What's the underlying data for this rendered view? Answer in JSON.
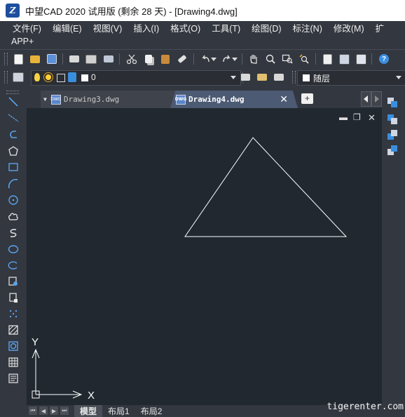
{
  "window": {
    "title": "中望CAD 2020 试用版 (剩余 28 天) - [Drawing4.dwg]",
    "logo_text": "Z"
  },
  "menu": {
    "items": [
      "文件(F)",
      "编辑(E)",
      "视图(V)",
      "插入(I)",
      "格式(O)",
      "工具(T)",
      "绘图(D)",
      "标注(N)",
      "修改(M)",
      "扩"
    ],
    "row2": [
      "APP+"
    ]
  },
  "layer_toolbar": {
    "current_layer": "0",
    "color_value": "随层"
  },
  "tabs": [
    {
      "label": "Drawing3.dwg",
      "active": false
    },
    {
      "label": "Drawing4.dwg",
      "active": true
    }
  ],
  "drawing": {
    "triangle": {
      "apex": [
        361,
        196
      ],
      "left": [
        264,
        337
      ],
      "right": [
        494,
        337
      ]
    },
    "ucs": {
      "y_label": "Y",
      "x_label": "X"
    }
  },
  "layout_tabs": [
    "模型",
    "布局1",
    "布局2"
  ],
  "watermark": "tigerenter.com",
  "colors": {
    "canvas_bg": "#212830",
    "ui_bg": "#33373f",
    "active_tab": "#4c5a73",
    "line": "#ffffff"
  }
}
